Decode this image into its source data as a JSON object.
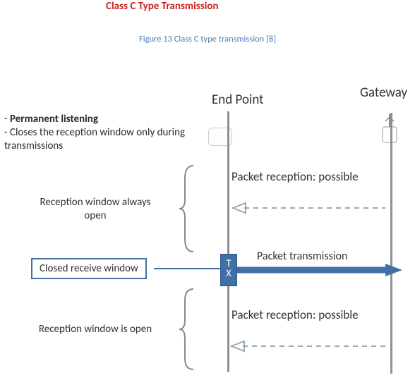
{
  "header": {
    "title": "Class C Type Transmission",
    "caption": "Figure 13 Class C type transmission [8]"
  },
  "labels": {
    "endpoint": "End Point",
    "gateway": "Gateway"
  },
  "description": {
    "line1": "Permanent listening",
    "line2": "- Closes the reception window only during transmissions"
  },
  "phases": {
    "top": "Reception window always open",
    "closed": "Closed receive window",
    "bottom": "Reception window is open"
  },
  "annotations": {
    "rx1": "Packet reception: possible",
    "tx": "Packet transmission",
    "rx2": "Packet reception: possible"
  },
  "txblock": {
    "l1": "T",
    "l2": "X"
  },
  "colors": {
    "title": "#c62323",
    "caption": "#4a7cb8",
    "accent": "#416fa6"
  }
}
